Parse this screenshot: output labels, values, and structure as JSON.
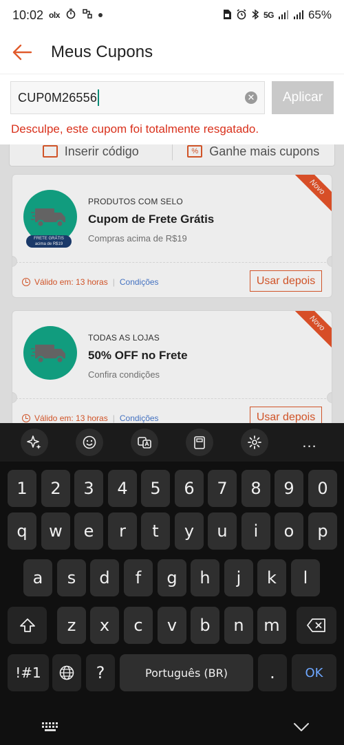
{
  "status_bar": {
    "time": "10:02",
    "left_icons": [
      "olx",
      "timer-icon",
      "vpn-icon",
      "dot"
    ],
    "olx_text": "olx",
    "right_icons": [
      "sim-icon",
      "alarm-icon",
      "bluetooth-icon",
      "5g-icon",
      "signal-icon",
      "signal-icon"
    ],
    "net_label": "5G",
    "battery": "65%"
  },
  "header": {
    "title": "Meus Cupons"
  },
  "coupon_input": {
    "value": "CUP0M26556",
    "apply_label": "Aplicar",
    "error": "Desculpe, este cupom foi totalmente resgatado."
  },
  "actions": {
    "insert_code": "Inserir código",
    "more_coupons": "Ganhe mais cupons"
  },
  "coupons": [
    {
      "ribbon": "Novo",
      "badge_line1": "FRETE GRÁTIS",
      "badge_line2": "acima de R$19",
      "category": "PRODUTOS COM SELO",
      "title": "Cupom de Frete Grátis",
      "subtitle": "Compras acima de R$19",
      "valid": "Válido em: 13 horas",
      "conditions": "Condições",
      "use_later": "Usar depois"
    },
    {
      "ribbon": "Novo",
      "category": "TODAS AS LOJAS",
      "title": "50% OFF no Frete",
      "subtitle": "Confira condições",
      "valid": "Válido em: 13 horas",
      "conditions": "Condições",
      "use_later": "Usar depois"
    }
  ],
  "keyboard": {
    "row_numbers": [
      "1",
      "2",
      "3",
      "4",
      "5",
      "6",
      "7",
      "8",
      "9",
      "0"
    ],
    "row_q": [
      "q",
      "w",
      "e",
      "r",
      "t",
      "y",
      "u",
      "i",
      "o",
      "p"
    ],
    "row_a": [
      "a",
      "s",
      "d",
      "f",
      "g",
      "h",
      "j",
      "k",
      "l"
    ],
    "row_z": [
      "z",
      "x",
      "c",
      "v",
      "b",
      "n",
      "m"
    ],
    "symbols_label": "!#1",
    "question_label": "?",
    "space_label": "Português (BR)",
    "period_label": ".",
    "ok_label": "OK",
    "more_label": "..."
  },
  "colors": {
    "accent": "#e05a2b",
    "error": "#d9301b",
    "brand_green": "#13a888",
    "link": "#4a7bd0"
  }
}
